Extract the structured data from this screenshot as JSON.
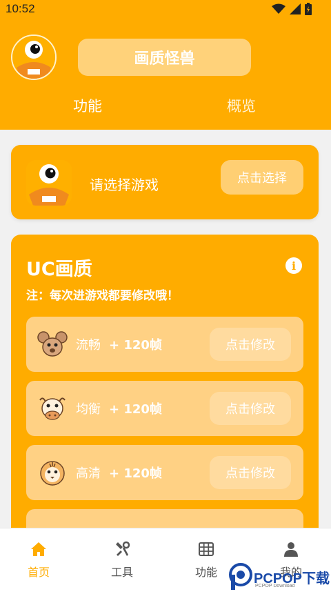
{
  "status_bar": {
    "time": "10:52",
    "icons": [
      "wifi-icon",
      "cell-signal-icon",
      "battery-icon"
    ]
  },
  "header": {
    "app_title": "画质怪兽",
    "tabs": [
      {
        "label": "功能",
        "active": true
      },
      {
        "label": "概览",
        "active": false
      }
    ]
  },
  "select_card": {
    "prompt": "请选择游戏",
    "button_label": "点击选择"
  },
  "uc_card": {
    "title": "UC画质",
    "note": "注：每次进游戏都要修改哦！",
    "info_icon": "info-icon",
    "modes": [
      {
        "name": "流畅",
        "fps": "+ 120帧",
        "button_label": "点击修改",
        "icon": "mouse-icon"
      },
      {
        "name": "均衡",
        "fps": "+ 120帧",
        "button_label": "点击修改",
        "icon": "cow-icon"
      },
      {
        "name": "高清",
        "fps": "+ 120帧",
        "button_label": "点击修改",
        "icon": "tiger-icon"
      }
    ]
  },
  "bottom_nav": {
    "items": [
      {
        "label": "首页",
        "icon": "home-icon",
        "active": true
      },
      {
        "label": "工具",
        "icon": "tools-icon",
        "active": false
      },
      {
        "label": "功能",
        "icon": "grid-icon",
        "active": false
      },
      {
        "label": "我的",
        "icon": "user-icon",
        "active": false
      }
    ]
  },
  "watermark": {
    "text": "PCPOP下载",
    "subtext": "PCPOP Download"
  },
  "colors": {
    "brand_orange": "#ffac00",
    "pill_light": "#ffd27a",
    "row_light": "#ffd184",
    "nav_active": "#ffac00"
  }
}
